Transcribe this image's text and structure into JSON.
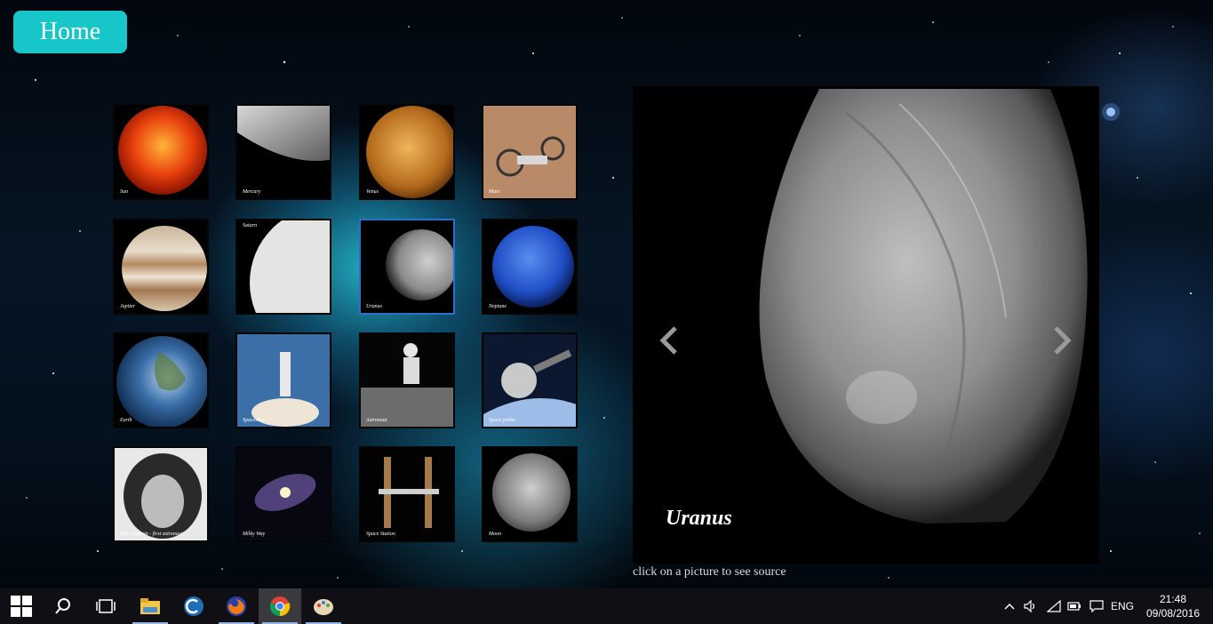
{
  "home_button": {
    "label": "Home"
  },
  "gallery": {
    "thumbnails": [
      {
        "caption": "Sun"
      },
      {
        "caption": "Mercury"
      },
      {
        "caption": "Venus"
      },
      {
        "caption": "Mars"
      },
      {
        "caption": "Jupiter"
      },
      {
        "caption": "Saturn"
      },
      {
        "caption": "Uranus"
      },
      {
        "caption": "Neptune"
      },
      {
        "caption": "Earth"
      },
      {
        "caption": "Spaceship"
      },
      {
        "caption": "Astronaut"
      },
      {
        "caption": "Space probe"
      },
      {
        "caption": "Yuri Gagarin - first astronaut"
      },
      {
        "caption": "Milky Way"
      },
      {
        "caption": "Space Station"
      },
      {
        "caption": "Moon"
      }
    ],
    "selected_index": 6
  },
  "viewer": {
    "caption": "Uranus",
    "prev_icon": "chevron-left-icon",
    "next_icon": "chevron-right-icon"
  },
  "hint": "click on a picture to see source",
  "taskbar": {
    "apps": [
      "start-icon",
      "search-icon",
      "task-view-icon",
      "file-explorer-icon",
      "ccleaner-icon",
      "firefox-icon",
      "chrome-icon",
      "paint-icon"
    ],
    "language": "ENG",
    "time": "21:48",
    "date": "09/08/2016"
  },
  "colors": {
    "home_button": "#17c6c9",
    "selected_border": "#2a6fc9",
    "taskbar": "#101014"
  }
}
